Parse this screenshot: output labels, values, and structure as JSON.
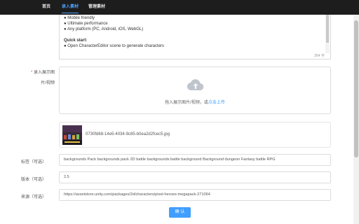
{
  "nav": {
    "items": [
      {
        "label": "首页",
        "active": false
      },
      {
        "label": "录入素材",
        "active": true
      },
      {
        "label": "管理素材",
        "active": false
      }
    ]
  },
  "editor": {
    "lines": [
      "● Mobile friendly",
      "● Ultimate performance",
      "● Any platform (PC, Android, iOS, WebGL)",
      "",
      "Quick start:",
      "● Open CharacterEditor scene to generate characters"
    ],
    "word_count": "364 字"
  },
  "upload": {
    "label_line1": "录入展示图",
    "label_line2": "片/视频",
    "required_mark": "*",
    "hint_prefix": "拖入展示图片/视频，或",
    "hint_link": "点击上传"
  },
  "file": {
    "name": "0730fd68-14e5-4034-9c85-b0ea2d2fcec5.jpg"
  },
  "fields": {
    "tags_label": "标签（可选）",
    "tags_value": "backgrounds Pack backgrounds pack 2D battle backgrounds battle background Background dungeon Fantasy battle RPG",
    "version_label": "版本（可选）",
    "version_value": "2.5",
    "source_label": "来源（可选）",
    "source_value": "https://assetstore.unity.com/packages/2d/characters/pixel-heroes-megapack-271064"
  },
  "submit": {
    "label": "确 认"
  },
  "colors": {
    "accent": "#409eff",
    "nav_bg": "#1d1d1d",
    "nav_active": "#4aa3ff"
  }
}
